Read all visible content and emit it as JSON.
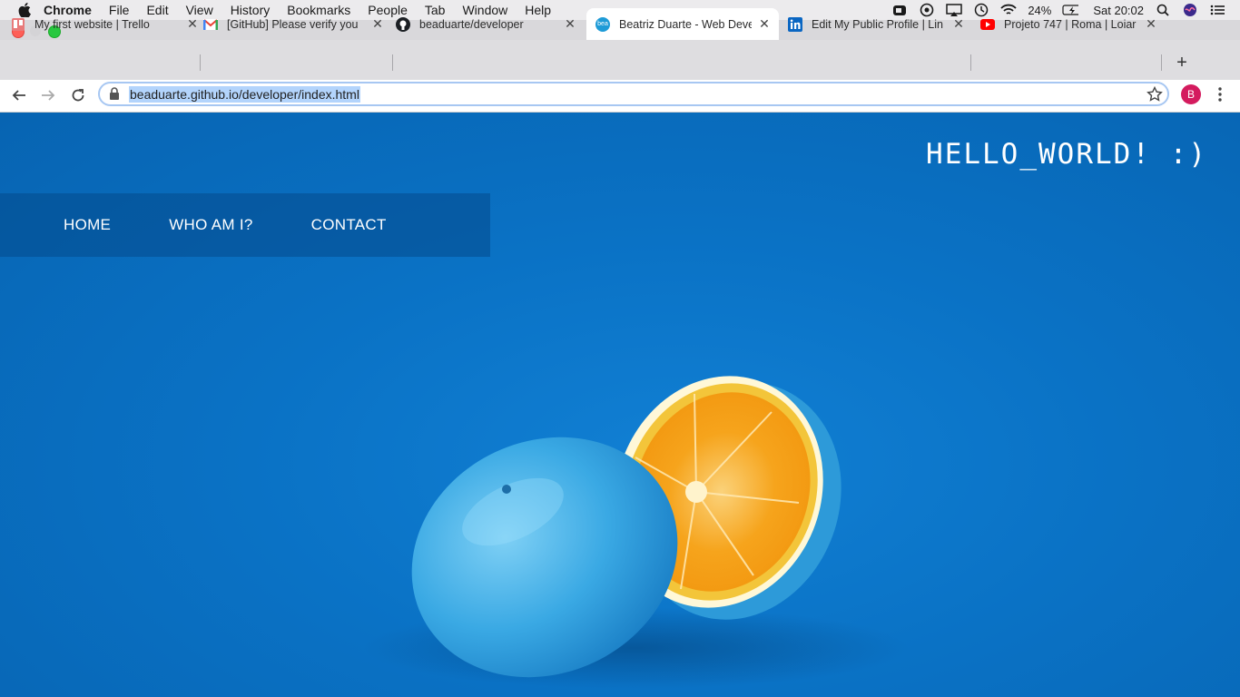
{
  "menubar": {
    "items": [
      "Chrome",
      "File",
      "Edit",
      "View",
      "History",
      "Bookmarks",
      "People",
      "Tab",
      "Window",
      "Help"
    ],
    "battery": "24%",
    "clock": "Sat 20:02"
  },
  "tabs": [
    {
      "title": "My first website | Trello",
      "icon": "trello-icon"
    },
    {
      "title": "[GitHub] Please verify you",
      "icon": "gmail-icon"
    },
    {
      "title": "beaduarte/developer",
      "icon": "github-icon"
    },
    {
      "title": "Beatriz Duarte - Web Deve",
      "icon": "bea-favicon",
      "active": true
    },
    {
      "title": "Edit My Public Profile | Lin",
      "icon": "linkedin-icon"
    },
    {
      "title": "Projeto 747 | Roma | Loiar",
      "icon": "youtube-icon"
    }
  ],
  "address_bar": {
    "url": "beaduarte.github.io/developer/index.html"
  },
  "profile": {
    "initial": "B"
  },
  "page": {
    "hero_title": "HELLO_WORLD! :)",
    "nav": [
      "HOME",
      "WHO AM I?",
      "CONTACT"
    ]
  },
  "colors": {
    "background": "#0a6fc2",
    "nav_bar": "#0a5a99",
    "accent_orange": "#f6a41c"
  }
}
